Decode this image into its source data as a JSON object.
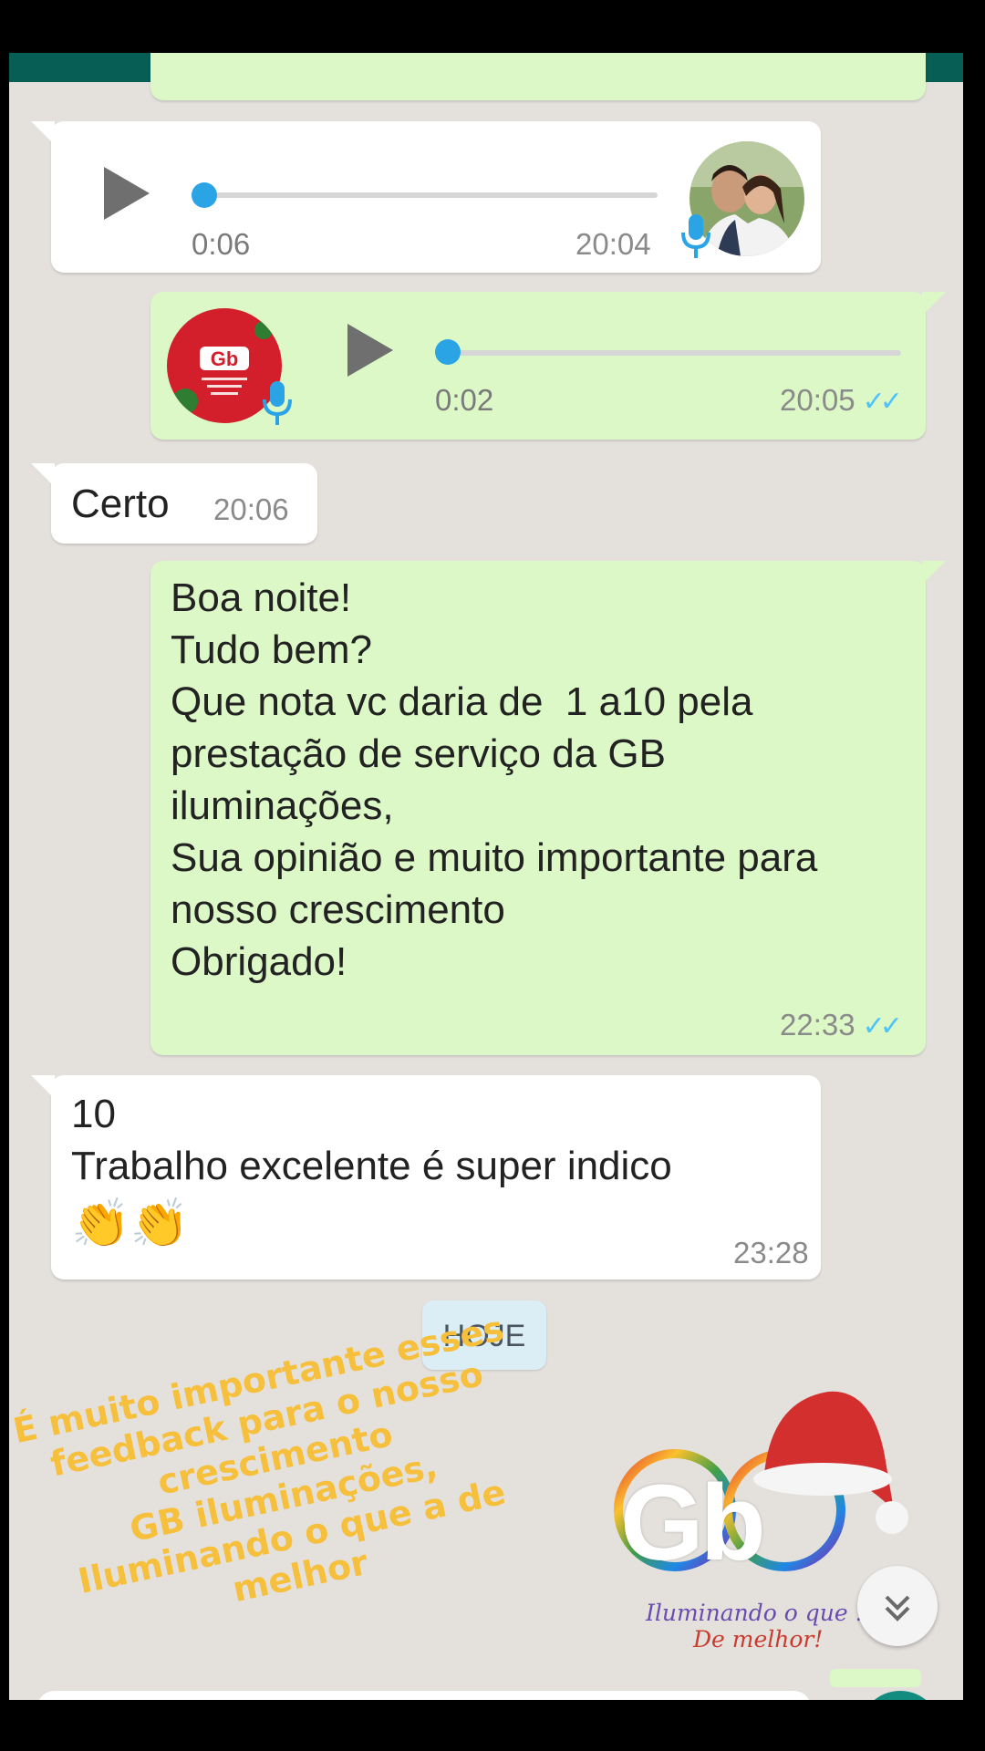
{
  "messages": {
    "voice_in": {
      "duration": "0:06",
      "time": "20:04",
      "progress": 0.0
    },
    "voice_out": {
      "duration": "0:02",
      "time": "20:05",
      "progress": 0.0
    },
    "certo": {
      "text": "Certo",
      "time": "20:06"
    },
    "survey": {
      "lines": [
        "Boa noite!",
        "Tudo bem?",
        "Que nota vc daria de  1 a10 pela",
        "prestação de serviço da GB",
        "iluminações,",
        "Sua opinião e muito importante para",
        "nosso crescimento",
        "Obrigado!"
      ],
      "time": "22:33"
    },
    "reply": {
      "line1": "10",
      "line2": "Trabalho excelente é super indico",
      "emoji": "👏👏",
      "time": "23:28"
    }
  },
  "date_chip": "HOJE",
  "overlay_caption": {
    "lines": [
      "É muito importante esses",
      "feedback para o nosso",
      "crescimento",
      "GB iluminações,",
      "Iluminando o que a de",
      "melhor"
    ],
    "color": "#f6bf3c"
  },
  "logo": {
    "wordmark": "Gb",
    "tagline_line1": "Iluminando o que .",
    "tagline_line2": "De melhor!"
  },
  "avatar_out_label": "Gb",
  "icons": {
    "scroll_down": "double-chevron-down-icon",
    "mic": "mic-icon",
    "play": "play-icon"
  },
  "colors": {
    "incoming": "#ffffff",
    "outgoing": "#dcf8c6",
    "chat_bg": "#e4e1dd",
    "tick_blue": "#4fc3f7",
    "header": "#075e54"
  }
}
